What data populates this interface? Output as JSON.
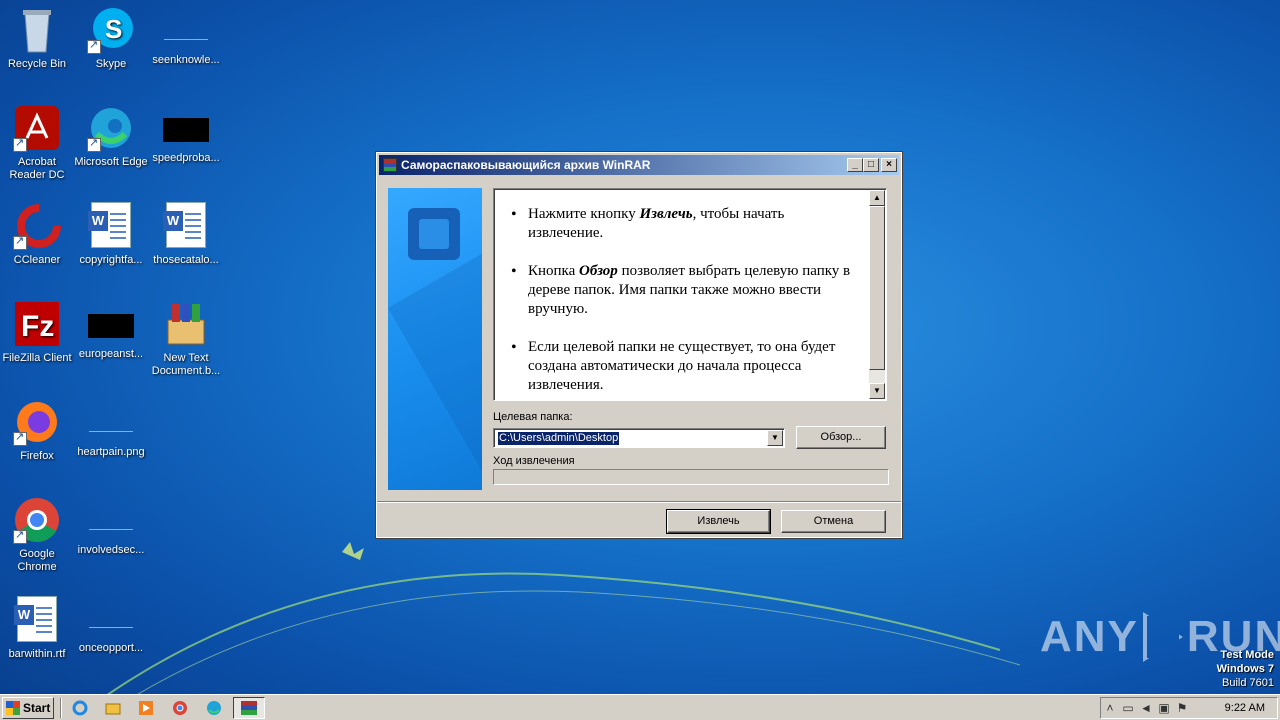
{
  "desktop": {
    "icons": [
      {
        "label": "Recycle Bin",
        "icon": "recycle-bin-icon"
      },
      {
        "label": "Skype",
        "icon": "skype-icon"
      },
      {
        "label": "seenknowle...",
        "icon": "blank-file-icon"
      },
      {
        "label": "Acrobat Reader DC",
        "icon": "acrobat-icon"
      },
      {
        "label": "Microsoft Edge",
        "icon": "edge-icon"
      },
      {
        "label": "speedproba...",
        "icon": "black-file-icon"
      },
      {
        "label": "CCleaner",
        "icon": "ccleaner-icon"
      },
      {
        "label": "copyrightfa...",
        "icon": "word-doc-icon"
      },
      {
        "label": "thosecatalo...",
        "icon": "word-doc-icon"
      },
      {
        "label": "FileZilla Client",
        "icon": "filezilla-icon"
      },
      {
        "label": "europeanst...",
        "icon": "black-file-icon"
      },
      {
        "label": "New Text Document.b...",
        "icon": "winrar-archive-icon"
      },
      {
        "label": "Firefox",
        "icon": "firefox-icon"
      },
      {
        "label": "heartpain.png",
        "icon": "blank-file-icon"
      },
      {
        "label": "Google Chrome",
        "icon": "chrome-icon"
      },
      {
        "label": "involvedsec...",
        "icon": "blank-file-icon"
      },
      {
        "label": "barwithin.rtf",
        "icon": "word-doc-icon"
      },
      {
        "label": "onceopport...",
        "icon": "blank-file-icon"
      }
    ]
  },
  "dialog": {
    "title": "Самораспаковывающийся архив WinRAR",
    "bullets": [
      {
        "pre": "Нажмите кнопку ",
        "bold": "Извлечь",
        "post": ", чтобы начать извлечение."
      },
      {
        "pre": "Кнопка ",
        "bold": "Обзор",
        "post": " позволяет выбрать целевую папку в дереве папок. Имя папки также можно ввести вручную."
      },
      {
        "pre": "Если целевой папки не существует, то она будет создана автоматически до начала процесса извлечения.",
        "bold": "",
        "post": ""
      }
    ],
    "target_label": "Целевая папка:",
    "target_value": "C:\\Users\\admin\\Desktop",
    "browse_label": "Обзор...",
    "progress_label": "Ход извлечения",
    "progress": 0,
    "extract_label": "Извлечь",
    "cancel_label": "Отмена"
  },
  "watermark": {
    "text_left": "ANY",
    "text_right": "RUN"
  },
  "os_info": {
    "line1": "Test Mode",
    "line2": "Windows 7",
    "line3": "Build 7601"
  },
  "taskbar": {
    "start_label": "Start",
    "quick_launch": [
      "ie-icon",
      "explorer-icon",
      "media-player-icon",
      "chrome-icon",
      "edge-icon"
    ],
    "active_task": "winrar-icon",
    "clock": "9:22 AM"
  },
  "colors": {
    "titlebar_start": "#0a246a",
    "titlebar_end": "#a6caf0",
    "desktop_blue": "#1570c8"
  }
}
